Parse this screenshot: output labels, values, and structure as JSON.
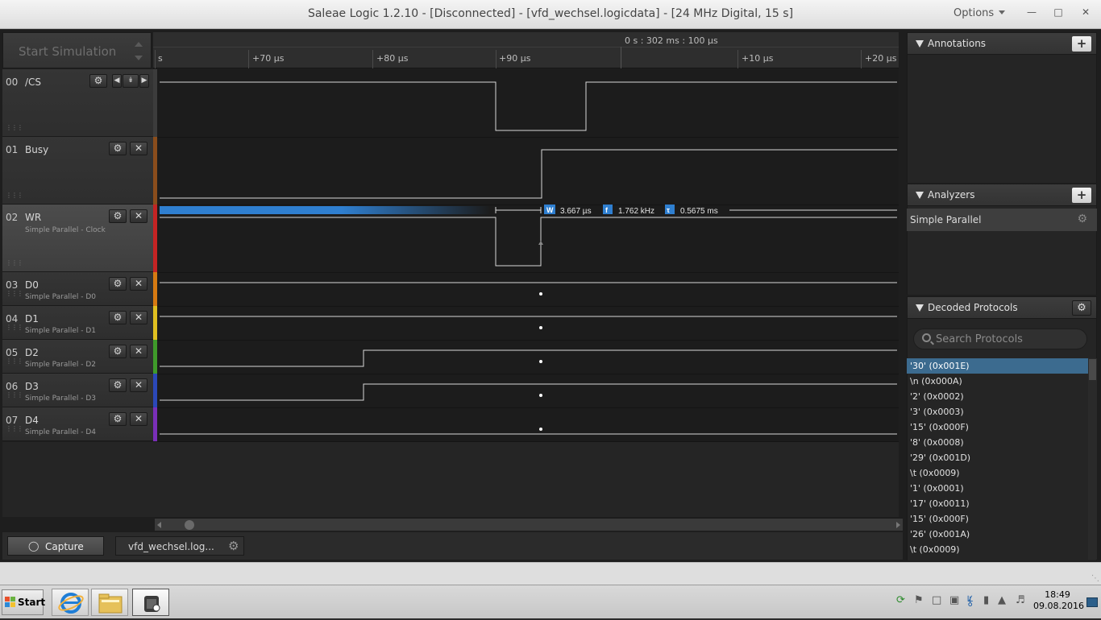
{
  "window": {
    "title": "Saleae Logic 1.2.10 - [Disconnected] - [vfd_wechsel.logicdata] - [24 MHz Digital, 15 s]",
    "options_label": "Options",
    "min_label": "—",
    "max_label": "□",
    "close_label": "✕"
  },
  "simulation": {
    "label": "Start Simulation"
  },
  "ruler": {
    "main_time": "0 s : 302 ms : 100 µs",
    "ticks": [
      "s",
      "+70 µs",
      "+80 µs",
      "+90 µs",
      "+10 µs",
      "+20 µs"
    ]
  },
  "channels": [
    {
      "num": "00",
      "name": "/CS",
      "sub": "",
      "color": "#3c3c3c"
    },
    {
      "num": "01",
      "name": "Busy",
      "sub": "",
      "color": "#8a4d1c"
    },
    {
      "num": "02",
      "name": "WR",
      "sub": "Simple Parallel - Clock",
      "color": "#c42424"
    },
    {
      "num": "03",
      "name": "D0",
      "sub": "Simple Parallel - D0",
      "color": "#d67a12"
    },
    {
      "num": "04",
      "name": "D1",
      "sub": "Simple Parallel - D1",
      "color": "#e0c020"
    },
    {
      "num": "05",
      "name": "D2",
      "sub": "Simple Parallel - D2",
      "color": "#3f9a2a"
    },
    {
      "num": "06",
      "name": "D3",
      "sub": "Simple Parallel - D3",
      "color": "#2b48b8"
    },
    {
      "num": "07",
      "name": "D4",
      "sub": "Simple Parallel - D4",
      "color": "#7a2fb8"
    }
  ],
  "measurement": {
    "width_label": "W",
    "width_value": "3.667 µs",
    "freq_label": "f",
    "freq_value": "1.762 kHz",
    "period_label": "τ",
    "period_value": "0.5675 ms"
  },
  "bottom_tabs": {
    "capture": "Capture",
    "file": "vfd_wechsel.log..."
  },
  "panels": {
    "annotations": "Annotations",
    "analyzers": "Analyzers",
    "analyzer_item": "Simple Parallel",
    "decoded": "Decoded Protocols",
    "search_placeholder": "Search Protocols",
    "add_label": "+",
    "decoded_items": [
      "'30' (0x001E)",
      "\\n (0x000A)",
      "'2' (0x0002)",
      "'3' (0x0003)",
      "'15' (0x000F)",
      "'8' (0x0008)",
      "'29' (0x001D)",
      "\\t (0x0009)",
      "'1' (0x0001)",
      "'17' (0x0011)",
      "'15' (0x000F)",
      "'26' (0x001A)",
      "\\t (0x0009)"
    ]
  },
  "taskbar": {
    "start": "Start",
    "time": "18:49",
    "date": "09.08.2016"
  }
}
